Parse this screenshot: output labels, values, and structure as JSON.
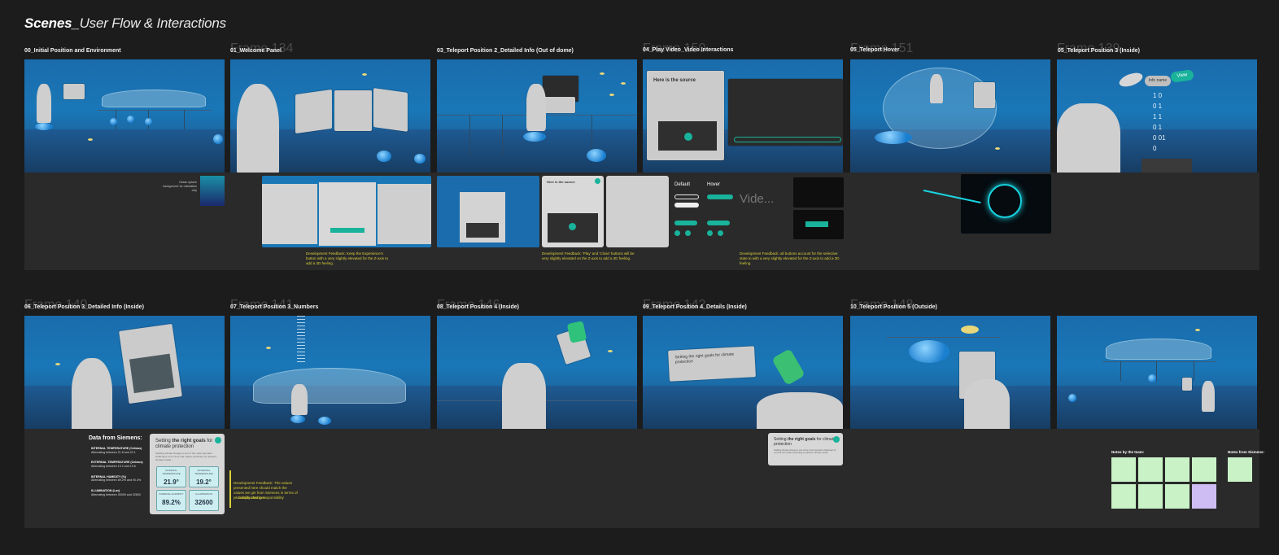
{
  "page": {
    "title_bold": "Scenes_",
    "title_light": "User Flow & Interactions"
  },
  "row1": [
    {
      "label": "00_Initial Position and Environment",
      "ghost": ""
    },
    {
      "label": "01_Welcome Panel",
      "ghost": "Frame 134"
    },
    {
      "label": "03_Teleport Position 2_Detailed Info (Out of dome)",
      "ghost": ""
    },
    {
      "label": "04_Play Video_Video Interactions",
      "ghost": "Frame 150"
    },
    {
      "label": "05_Teleport Hover",
      "ghost": "Frame 151"
    },
    {
      "label": "05_Teleport Position 3 (Inside)",
      "ghost": "Frame 139"
    }
  ],
  "row2": [
    {
      "label": "06_Teleport Position 3_Detailed Info (Inside)",
      "ghost": "Frame 140"
    },
    {
      "label": "07_Teleport Position 3_Numbers",
      "ghost": "Frame 141"
    },
    {
      "label": "08_Teleport Position 4 (Inside)",
      "ghost": "Frame 146"
    },
    {
      "label": "09_Teleport Position 4_Details (Inside)",
      "ghost": "Frame 142"
    },
    {
      "label": "10_Teleport Position 5 (Outside)",
      "ghost": "Frame 148"
    }
  ],
  "band1": {
    "gradient_note": "Ocean sphere background: for orientation only",
    "dev_note_1": "Development Feedback: Keep the Experience's button with a very slightly elevated for the Z-axis to add a 3D feeling.",
    "dev_note_2": "Development Feedback: 'Play' and 'Close' buttons will be very slightly elevated on the Z-axis to add a 3D feeling.",
    "dev_note_3": "Development Feedback: all buttons account for the selective state in with a very slightly elevated for the Z-axis to add a 3D feeling.",
    "states": {
      "default": "Default",
      "hover": "Hover"
    },
    "ghost_frame": "Fram...",
    "ghost_video": "Vide..."
  },
  "scene_text": {
    "info_name": "Info name",
    "view": "View",
    "binary": [
      "1 0",
      "0 1",
      "1 0",
      "1 1",
      "0 1",
      "0 01",
      "1",
      "0"
    ],
    "dome_card_title": "Setting the right goals for climate protection",
    "video_card_title": "Here is the source"
  },
  "siemens": {
    "title": "Data from Siemens:",
    "items": [
      {
        "name": "INTERNAL TEMPERATURE (Celsius)",
        "desc": "Alternating between 21.8 and 22.1"
      },
      {
        "name": "EXTERNAL TEMPERATURE (Celsius)",
        "desc": "Alternating between 19.2 and 19.6"
      },
      {
        "name": "INTERNAL HUMIDITY (%)",
        "desc": "Alternating between 89.2% and 90.4%"
      },
      {
        "name": "ILLUMINATION (Lux)",
        "desc": "Alternating between 30000 and 32600"
      }
    ]
  },
  "climate_card": {
    "title_pre": "Setting ",
    "title_bold": "the right goals",
    "title_post": " for climate protection",
    "body": "Tackling climate change is one of the most important challenges of our time and makes protecting our planet's climate crucial.",
    "metrics": [
      {
        "label": "INTERNAL TEMPERATURE",
        "value": "21.9°"
      },
      {
        "label": "EXTERNAL TEMPERATURE",
        "value": "19.2°"
      },
      {
        "label": "INTERNAL HUMIDITY",
        "value": "89.2%"
      },
      {
        "label": "ILLUMINATION",
        "value": "32600"
      }
    ]
  },
  "climate_card_small": {
    "title_pre": "Setting ",
    "title_bold": "the right goals",
    "title_post": " for climate protection",
    "body": "Tackling climate change is one of the most important challenges of our time and makes protecting our planet's climate crucial."
  },
  "dev_note_siemens": {
    "text": "Development Feedback: The values presented here should match the values we get from Siemens in terms of probability changes.",
    "bullet": "+ complicated in responsibility"
  },
  "notes": {
    "team": "Notes by the team:",
    "siemens": "Notes from Siemens:"
  },
  "colors": {
    "background": "#1c1c1c",
    "band": "#2a2a2a",
    "scene_water": "#1a77b7",
    "accent_teal": "#19b29b",
    "note_yellow": "#d8cf3a",
    "sticky_green": "#c9f2c7",
    "sticky_violet": "#cdbdf2"
  }
}
